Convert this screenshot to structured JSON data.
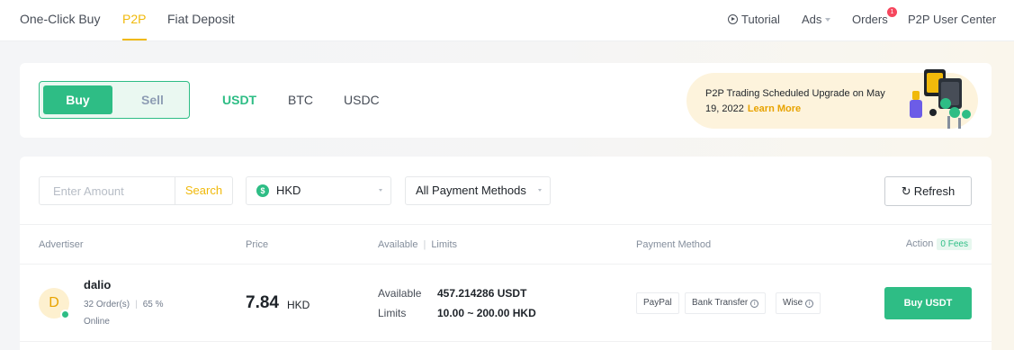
{
  "nav": {
    "tabs": [
      {
        "label": "One-Click Buy",
        "active": false
      },
      {
        "label": "P2P",
        "active": true
      },
      {
        "label": "Fiat Deposit",
        "active": false
      }
    ],
    "tutorial_label": "Tutorial",
    "ads_label": "Ads",
    "orders_label": "Orders",
    "orders_badge": "1",
    "user_center_label": "P2P User Center"
  },
  "trade": {
    "buy_label": "Buy",
    "sell_label": "Sell",
    "active_side": "Buy",
    "coins": [
      {
        "label": "USDT",
        "active": true
      },
      {
        "label": "BTC",
        "active": false
      },
      {
        "label": "USDC",
        "active": false
      }
    ]
  },
  "banner": {
    "text": "P2P Trading Scheduled Upgrade on May 19, 2022",
    "link": "Learn More"
  },
  "filters": {
    "amount_placeholder": "Enter Amount",
    "search_label": "Search",
    "currency": "HKD",
    "payment_method": "All Payment Methods",
    "refresh_label": "Refresh"
  },
  "table": {
    "headers": {
      "advertiser": "Advertiser",
      "price": "Price",
      "available": "Available",
      "limits": "Limits",
      "payment": "Payment Method",
      "action": "Action",
      "fees": "0 Fees"
    },
    "rows": [
      {
        "avatar_letter": "D",
        "name": "dalio",
        "orders": "32 Order(s)",
        "completion": "65 %",
        "status": "Online",
        "price": "7.84",
        "currency": "HKD",
        "available_label": "Available",
        "available": "457.214286 USDT",
        "limits_label": "Limits",
        "limits": "10.00 ~ 200.00 HKD",
        "payment_methods": [
          "PayPal",
          "Bank Transfer",
          "Wise"
        ],
        "action_label": "Buy USDT"
      }
    ]
  },
  "colors": {
    "brand": "#f0b90b",
    "buy_green": "#2ebd85",
    "badge_red": "#f6465d",
    "text": "#1e2329"
  },
  "icons": [
    "play-circle-icon",
    "caret-down-icon",
    "hkd-coin-icon",
    "refresh-icon",
    "info-icon",
    "online-dot-icon"
  ]
}
